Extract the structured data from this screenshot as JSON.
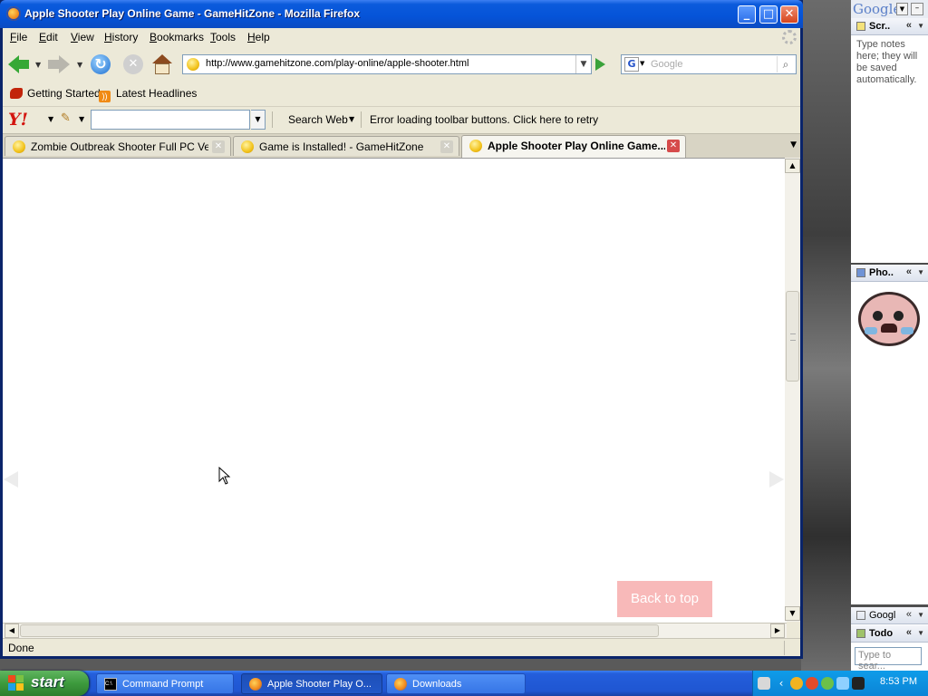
{
  "window": {
    "title": "Apple Shooter Play Online Game - GameHitZone - Mozilla Firefox",
    "controls": {
      "minimize": "_",
      "maximize": "□",
      "close": "✕"
    }
  },
  "menubar": {
    "items": [
      {
        "label": "File",
        "accel": "F",
        "rest": "ile"
      },
      {
        "label": "Edit",
        "accel": "E",
        "rest": "dit"
      },
      {
        "label": "View",
        "accel": "V",
        "rest": "iew"
      },
      {
        "label": "History",
        "accel": "H",
        "rest": "istory"
      },
      {
        "label": "Bookmarks",
        "accel": "B",
        "rest": "ookmarks"
      },
      {
        "label": "Tools",
        "accel": "T",
        "rest": "ools"
      },
      {
        "label": "Help",
        "accel": "H",
        "rest": "elp"
      }
    ]
  },
  "navbar": {
    "url": "http://www.gamehitzone.com/play-online/apple-shooter.html",
    "search_placeholder": "Google",
    "search_engine_letter": "G",
    "icons": [
      "back-icon",
      "forward-icon",
      "reload-icon",
      "stop-icon",
      "home-icon",
      "go-icon",
      "search-icon"
    ]
  },
  "bookmarks": {
    "items": [
      {
        "label": "Getting Started",
        "icon": "getting-started-icon"
      },
      {
        "label": "Latest Headlines",
        "icon": "rss-icon"
      }
    ]
  },
  "yahoo_toolbar": {
    "logo": "Y!",
    "search_button": "Search Web",
    "error": "Error loading toolbar buttons. Click here to retry"
  },
  "tabs": [
    {
      "label": "Zombie Outbreak Shooter Full PC Versi...",
      "active": false
    },
    {
      "label": "Game is Installed! - GameHitZone",
      "active": false
    },
    {
      "label": "Apple Shooter Play Online Game...",
      "active": true
    }
  ],
  "content": {
    "back_to_top": "Back to top"
  },
  "status": {
    "text": "Done"
  },
  "google_sidebar": {
    "logo": "Google",
    "scratch_title": "Scr..",
    "scratch_text": "Type notes here; they will be saved automatically.",
    "photo_title": "Pho..",
    "mini_title": "Googl",
    "todo_title": "Todo",
    "todo_placeholder": "Type to sear..."
  },
  "taskbar": {
    "start_label": "start",
    "tasks": [
      {
        "label": "Command Prompt",
        "icon": "cmd-icon",
        "active": false
      },
      {
        "label": "Apple Shooter Play O...",
        "icon": "firefox-icon",
        "active": true
      },
      {
        "label": "Downloads",
        "icon": "firefox-icon",
        "active": false
      }
    ],
    "time": "8:53 PM"
  },
  "colors": {
    "titlebar": "#0553d8",
    "chrome": "#ece9d8",
    "back_to_top_bg": "#f8b9b9",
    "taskbar": "#245edb",
    "start": "#3d9a3d"
  }
}
